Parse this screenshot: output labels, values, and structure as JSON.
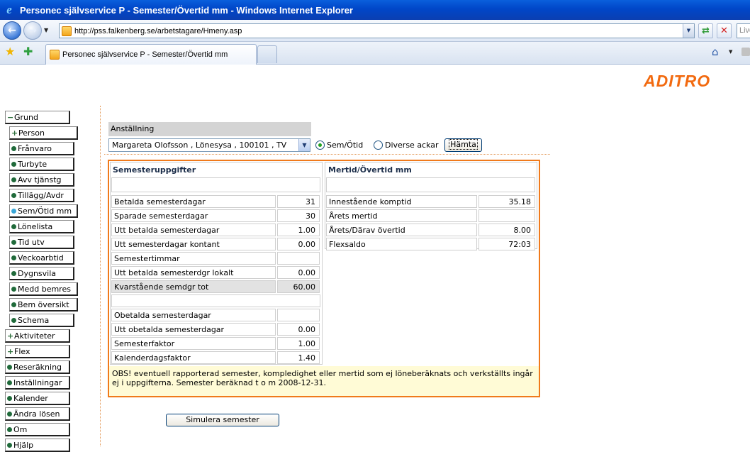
{
  "window": {
    "title": "Personec självservice P - Semester/Övertid mm - Windows Internet Explorer",
    "url": "http://pss.falkenberg.se/arbetstagare/Hmeny.asp",
    "search_placeholder": "Live Search",
    "tab_title": "Personec självservice P - Semester/Övertid mm"
  },
  "brand": {
    "name": "ADITRO",
    "color": "#f26a10"
  },
  "menu": {
    "items": [
      {
        "label": "Grund",
        "mark": "minus"
      },
      {
        "label": "Person",
        "mark": "plus"
      },
      {
        "label": "Frånvaro",
        "mark": "dot"
      },
      {
        "label": "Turbyte",
        "mark": "dot"
      },
      {
        "label": "Avv tjänstg",
        "mark": "dot"
      },
      {
        "label": "Tillägg/Avdr",
        "mark": "dot"
      },
      {
        "label": "Sem/Ötid mm",
        "mark": "dot-active"
      },
      {
        "label": "Lönelista",
        "mark": "dot"
      },
      {
        "label": "Tid utv",
        "mark": "dot"
      },
      {
        "label": "Veckoarbtid",
        "mark": "dot"
      },
      {
        "label": "Dygnsvila",
        "mark": "dot"
      },
      {
        "label": "Medd bemres",
        "mark": "dot"
      },
      {
        "label": "Bem översikt",
        "mark": "dot"
      },
      {
        "label": "Schema",
        "mark": "dot"
      },
      {
        "label": "Aktiviteter",
        "mark": "plus"
      },
      {
        "label": "Flex",
        "mark": "plus"
      },
      {
        "label": "Reseräkning",
        "mark": "dot"
      },
      {
        "label": "Inställningar",
        "mark": "dot"
      },
      {
        "label": "Kalender",
        "mark": "dot"
      },
      {
        "label": "Ändra lösen",
        "mark": "dot"
      },
      {
        "label": "Om",
        "mark": "dot"
      },
      {
        "label": "Hjälp",
        "mark": "dot"
      }
    ]
  },
  "employment": {
    "label": "Anställning",
    "selected": "Margareta Olofsson , Lönesysa , 100101 , TV",
    "radio_sem": "Sem/Ötid",
    "radio_misc": "Diverse ackar",
    "fetch_label": "Hämta"
  },
  "vacation": {
    "title": "Semesteruppgifter",
    "rows": [
      {
        "label": "Betalda semesterdagar",
        "value": "31"
      },
      {
        "label": "Sparade semesterdagar",
        "value": "30"
      },
      {
        "label": "Utt betalda semesterdagar",
        "value": "1.00"
      },
      {
        "label": "Utt semesterdagar kontant",
        "value": "0.00"
      },
      {
        "label": "Semestertimmar",
        "value": ""
      },
      {
        "label": "Utt betalda semesterdgr lokalt",
        "value": "0.00"
      },
      {
        "label": "Kvarstående semdgr tot",
        "value": "60.00"
      },
      {
        "label": "Obetalda semesterdagar",
        "value": ""
      },
      {
        "label": "Utt obetalda semesterdagar",
        "value": "0.00"
      },
      {
        "label": "Semesterfaktor",
        "value": "1.00"
      },
      {
        "label": "Kalenderdagsfaktor",
        "value": "1.40"
      }
    ]
  },
  "overtime": {
    "title": "Mertid/Övertid mm",
    "rows": [
      {
        "label": "Innestående komptid",
        "value": "35.18"
      },
      {
        "label": "Årets mertid",
        "value": ""
      },
      {
        "label": "Årets/Därav övertid",
        "value": "8.00"
      },
      {
        "label": "Flexsaldo",
        "value": "72:03"
      }
    ]
  },
  "notice": "OBS! eventuell rapporterad semester, kompledighet eller mertid som ej löneberäknats och verkställts ingår ej i uppgifterna. Semester beräknad t o m 2008-12-31.",
  "simulate_label": "Simulera semester"
}
